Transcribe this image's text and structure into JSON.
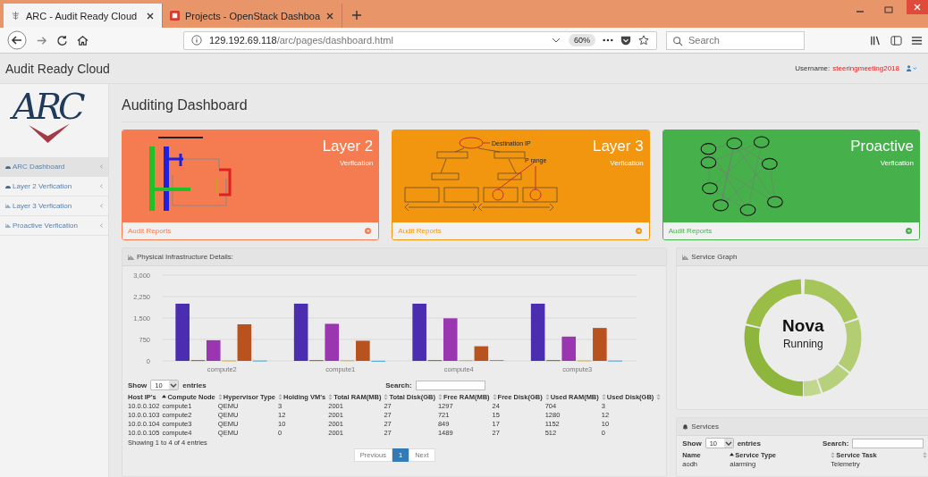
{
  "browser": {
    "tabs": [
      {
        "title": "ARC - Audit Ready Cloud",
        "selected": true
      },
      {
        "title": "Projects - OpenStack Dashboa",
        "selected": false
      }
    ],
    "url_host": "129.192.69.118",
    "url_path": "/arc/pages/dashboard.html",
    "zoom": "60%",
    "search": {
      "placeholder": "Search"
    }
  },
  "header": {
    "title": "Audit Ready Cloud",
    "username_label": "Username:",
    "username": "steeringmeeting2018"
  },
  "sidebar": {
    "logo": "ARC",
    "items": [
      {
        "label": "ARC Dashboard",
        "kind": "dashboard",
        "selected": true
      },
      {
        "label": "Layer 2 Verfication",
        "kind": "dashboard",
        "selected": false
      },
      {
        "label": "Layer 3 Verfication",
        "kind": "chart",
        "selected": false
      },
      {
        "label": "Proactive Verfication",
        "kind": "chart",
        "selected": false
      }
    ]
  },
  "page_title": "Auditing Dashboard",
  "cards": [
    {
      "kind": "layer2",
      "title": "Layer 2",
      "subtitle": "Verfication",
      "footer": "Audit Reports",
      "color": "#f47c50"
    },
    {
      "kind": "layer3",
      "title": "Layer 3",
      "subtitle": "Verfication",
      "footer": "Audit Reports",
      "color": "#f3960f",
      "labels": [
        "Destination IP",
        "P range"
      ]
    },
    {
      "kind": "proactive",
      "title": "Proactive",
      "subtitle": "Verfication",
      "footer": "Audit Reports",
      "color": "#46b14b"
    }
  ],
  "infrastructure": {
    "title": "Physical Infrastructure Details:",
    "chart_data": {
      "type": "bar",
      "grid": true,
      "categories": [
        "compute2",
        "compute1",
        "compute4",
        "compute3"
      ],
      "ylim": [
        0,
        3000
      ],
      "yticks": [
        {
          "value": 0,
          "label": "0"
        },
        {
          "value": 750,
          "label": "750"
        },
        {
          "value": 1500,
          "label": "1,500"
        },
        {
          "value": 2250,
          "label": "2,250"
        },
        {
          "value": 3000,
          "label": "3,000"
        }
      ],
      "series": [
        {
          "color": "#4b2db0",
          "values": [
            2001,
            2001,
            2001,
            2001
          ]
        },
        {
          "color": "#7d6a28",
          "values": [
            27,
            27,
            27,
            27
          ]
        },
        {
          "color": "#9a36b0",
          "values": [
            721,
            1297,
            1489,
            849
          ]
        },
        {
          "color": "#d6b23a",
          "values": [
            15,
            24,
            27,
            17
          ]
        },
        {
          "color": "#b8531f",
          "values": [
            1280,
            704,
            512,
            1152
          ]
        },
        {
          "color": "#4aa3d8",
          "values": [
            12,
            3,
            0,
            10
          ]
        }
      ]
    },
    "table": {
      "show_label": "Show",
      "page_size": "10",
      "entries_label": "entries",
      "search_label": "Search:",
      "columns": [
        {
          "label": "Host IP's"
        },
        {
          "label": "Compute Node",
          "sorted": true
        },
        {
          "label": "Hypervisor Type",
          "sorted": false
        },
        {
          "label": "Holding VM's",
          "sorted": false
        },
        {
          "label": "Total RAM(MB)",
          "sorted": false
        },
        {
          "label": "Total Disk(GB)",
          "sorted": false
        },
        {
          "label": "Free RAM(MB)",
          "sorted": false
        },
        {
          "label": "Free Disk(GB)",
          "sorted": false
        },
        {
          "label": "Used RAM(MB)",
          "sorted": false
        },
        {
          "label": "Used Disk(GB)",
          "sorted": false
        },
        {
          "sorted": false
        }
      ],
      "rows": [
        [
          "10.0.0.102",
          "compute1",
          "QEMU",
          "3",
          "2001",
          "27",
          "1297",
          "24",
          "704",
          "3"
        ],
        [
          "10.0.0.103",
          "compute2",
          "QEMU",
          "12",
          "2001",
          "27",
          "721",
          "15",
          "1280",
          "12"
        ],
        [
          "10.0.0.104",
          "compute3",
          "QEMU",
          "10",
          "2001",
          "27",
          "849",
          "17",
          "1152",
          "10"
        ],
        [
          "10.0.0.105",
          "compute4",
          "QEMU",
          "0",
          "2001",
          "27",
          "1489",
          "27",
          "512",
          "0"
        ]
      ],
      "info": "Showing 1 to 4 of 4 entries",
      "pagination": [
        {
          "label": "Previous",
          "selected": false
        },
        {
          "label": "1",
          "selected": true
        },
        {
          "label": "Next",
          "selected": false
        }
      ]
    }
  },
  "service_graph": {
    "title": "Service Graph",
    "service": "Nova",
    "status": "Running"
  },
  "services": {
    "title": "Services",
    "table": {
      "show_label": "Show",
      "page_size": "10",
      "entries_label": "entries",
      "search_label": "Search:",
      "columns": [
        {
          "label": "Name"
        },
        {
          "label": "Service Type",
          "sorted": true
        },
        {
          "label": "Service Task",
          "sorted": false
        },
        {
          "sorted": false
        }
      ],
      "rows": [
        [
          "aodh",
          "alarming",
          "Telemetry"
        ]
      ]
    }
  }
}
